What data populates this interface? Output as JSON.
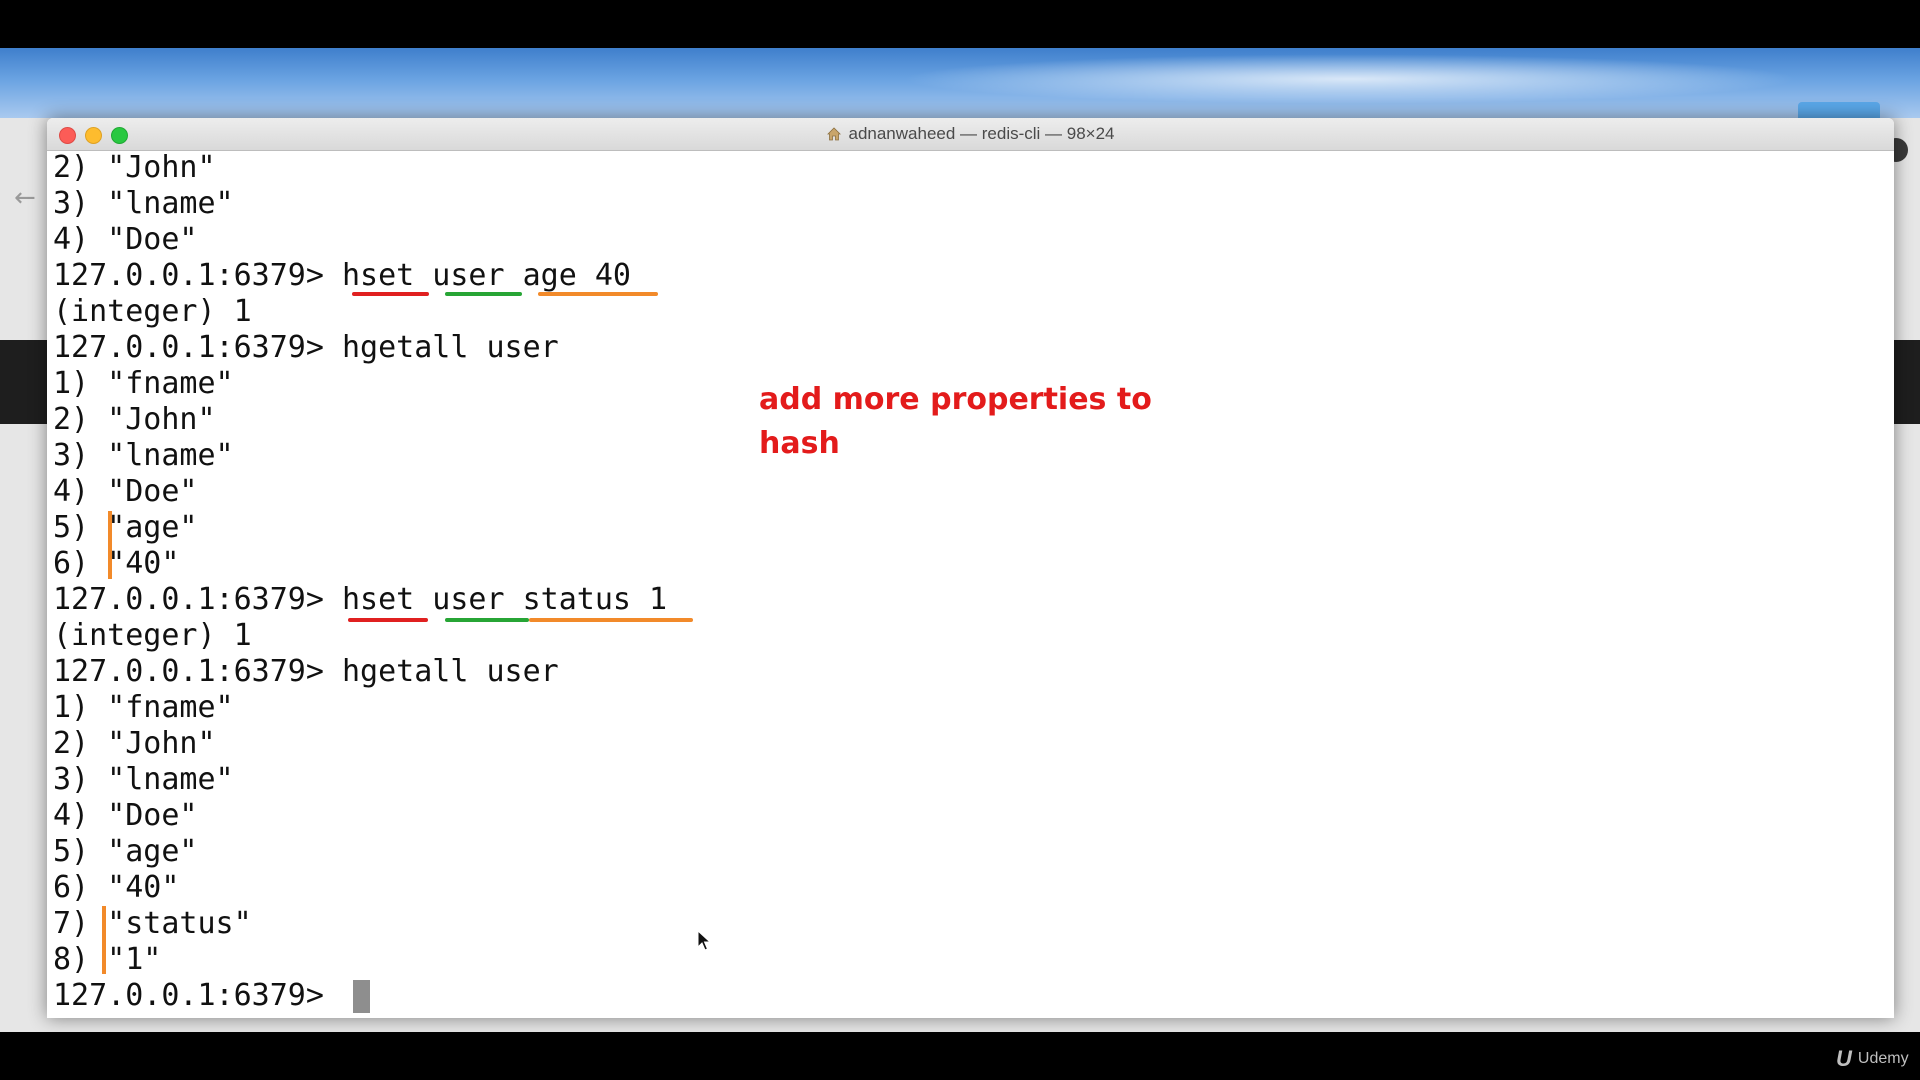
{
  "window": {
    "title": "adnanwaheed — redis-cli — 98×24"
  },
  "terminal": {
    "lines": [
      "2) \"John\"",
      "3) \"lname\"",
      "4) \"Doe\"",
      "127.0.0.1:6379> hset user age 40",
      "(integer) 1",
      "127.0.0.1:6379> hgetall user",
      "1) \"fname\"",
      "2) \"John\"",
      "3) \"lname\"",
      "4) \"Doe\"",
      "5) \"age\"",
      "6) \"40\"",
      "127.0.0.1:6379> hset user status 1",
      "(integer) 1",
      "127.0.0.1:6379> hgetall user",
      "1) \"fname\"",
      "2) \"John\"",
      "3) \"lname\"",
      "4) \"Doe\"",
      "5) \"age\"",
      "6) \"40\"",
      "7) \"status\"",
      "8) \"1\"",
      "127.0.0.1:6379> "
    ]
  },
  "annotation": {
    "text": "add more properties to hash",
    "color": "#e31b1b"
  },
  "colors": {
    "command_underline": "#e02020",
    "key_underline": "#27a535",
    "field_underline": "#f28a2a"
  },
  "icons": [
    "home-icon",
    "mouse-pointer-icon",
    "back-arrow-icon"
  ],
  "watermark": {
    "text": "Udemy"
  }
}
